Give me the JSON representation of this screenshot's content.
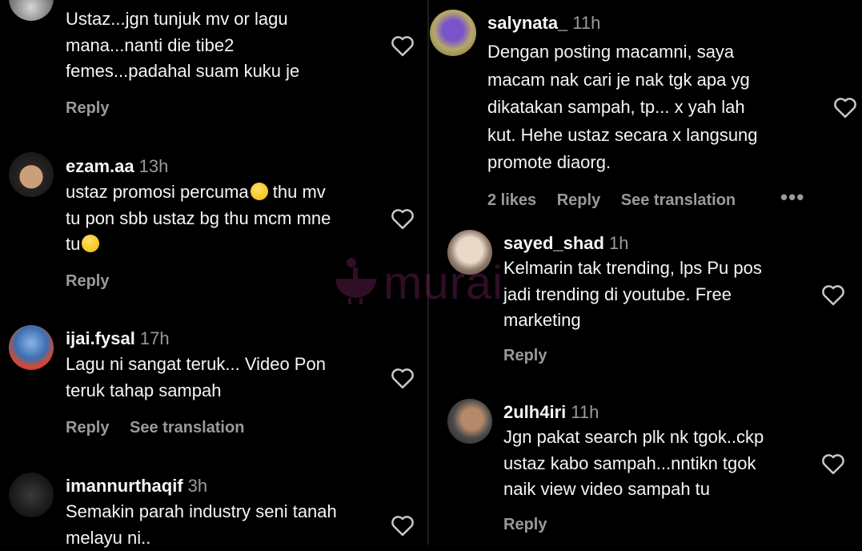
{
  "left": {
    "c1": {
      "lines": [
        "Ustaz...jgn tunjuk mv or lagu",
        "mana...nanti die tibe2",
        "femes...padahal suam kuku je"
      ],
      "reply": "Reply"
    },
    "c2": {
      "user": "ezam.aa",
      "time": "13h",
      "line1": "ustaz promosi percuma",
      "line2": "thu mv",
      "line3": "tu pon sbb ustaz bg thu mcm mne",
      "line4": "tu",
      "reply": "Reply"
    },
    "c3": {
      "user": "ijai.fysal",
      "time": "17h",
      "lines": [
        "Lagu ni sangat teruk... Video Pon",
        "teruk tahap sampah"
      ],
      "reply": "Reply",
      "translate": "See translation"
    },
    "c4": {
      "user": "imannurthaqif",
      "time": "3h",
      "lines": [
        "Semakin parah industry seni tanah",
        "melayu ni.."
      ]
    }
  },
  "right": {
    "c1": {
      "user": "salynata_",
      "time": "11h",
      "lines": [
        "Dengan posting macamni, saya",
        "macam nak cari je nak tgk apa yg",
        "dikatakan sampah, tp... x yah lah",
        "kut. Hehe ustaz secara x langsung",
        "promote diaorg."
      ],
      "likes": "2 likes",
      "reply": "Reply",
      "translate": "See translation",
      "more": "•••"
    },
    "c2": {
      "user": "sayed_shad",
      "time": "1h",
      "lines": [
        "Kelmarin tak trending, lps Pu pos",
        "jadi trending di youtube. Free",
        "marketing"
      ],
      "reply": "Reply"
    },
    "c3": {
      "user": "2ulh4iri",
      "time": "11h",
      "lines": [
        "Jgn pakat search plk nk tgok..ckp",
        "ustaz kabo sampah...nntikn tgok",
        "naik view video sampah tu"
      ],
      "reply": "Reply"
    }
  },
  "watermark": "murai",
  "colors": {
    "background": "#000000",
    "text": "#f2f2f2",
    "muted": "#9a9a9a",
    "watermark": "#8a2a6a"
  },
  "icons": {
    "like": "heart-outline-icon",
    "more": "more-dots-icon"
  }
}
